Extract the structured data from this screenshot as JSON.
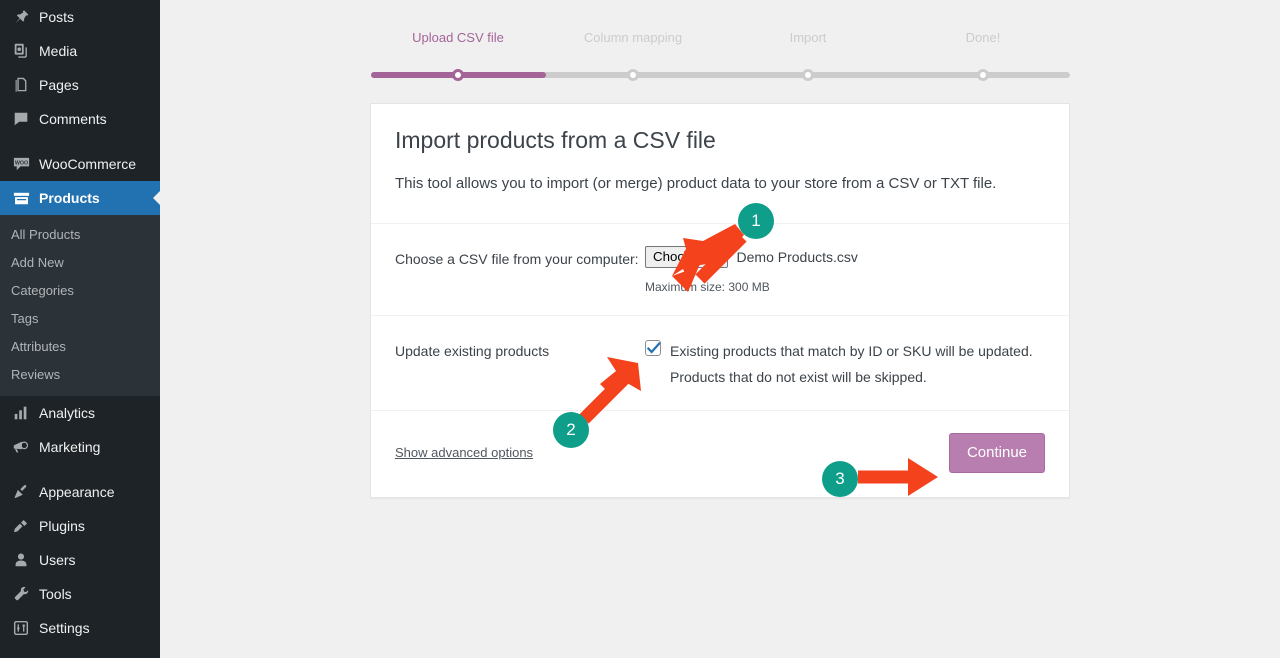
{
  "colors": {
    "sidebar_bg": "#1d2327",
    "submenu_bg": "#2c3338",
    "current_item_bg": "#2271b1",
    "page_bg": "#f0f0f1",
    "accent_purple": "#a46497",
    "button_purple": "#b87eb0",
    "annotation_teal": "#0e9e8a",
    "annotation_orange": "#f4421c",
    "checkbox_blue": "#2271b1"
  },
  "sidebar": {
    "groups": [
      {
        "items": [
          {
            "label": "Posts",
            "icon": "pin-icon",
            "current": false
          },
          {
            "label": "Media",
            "icon": "media-icon",
            "current": false
          },
          {
            "label": "Pages",
            "icon": "pages-icon",
            "current": false
          },
          {
            "label": "Comments",
            "icon": "comment-icon",
            "current": false
          }
        ]
      },
      {
        "items": [
          {
            "label": "WooCommerce",
            "icon": "woocommerce-icon",
            "current": false
          },
          {
            "label": "Products",
            "icon": "products-box-icon",
            "current": true
          }
        ],
        "submenu": [
          "All Products",
          "Add New",
          "Categories",
          "Tags",
          "Attributes",
          "Reviews"
        ]
      },
      {
        "items": [
          {
            "label": "Analytics",
            "icon": "bar-chart-icon",
            "current": false
          },
          {
            "label": "Marketing",
            "icon": "megaphone-icon",
            "current": false
          }
        ]
      },
      {
        "items": [
          {
            "label": "Appearance",
            "icon": "paintbrush-icon",
            "current": false
          },
          {
            "label": "Plugins",
            "icon": "plug-icon",
            "current": false
          },
          {
            "label": "Users",
            "icon": "user-icon",
            "current": false
          },
          {
            "label": "Tools",
            "icon": "wrench-icon",
            "current": false
          },
          {
            "label": "Settings",
            "icon": "sliders-icon",
            "current": false
          }
        ]
      }
    ]
  },
  "stepper": {
    "steps": [
      {
        "label": "Upload CSV file",
        "state": "active"
      },
      {
        "label": "Column mapping",
        "state": "upcoming"
      },
      {
        "label": "Import",
        "state": "upcoming"
      },
      {
        "label": "Done!",
        "state": "upcoming"
      }
    ],
    "progress_percent": 25
  },
  "card": {
    "title": "Import products from a CSV file",
    "description": "This tool allows you to import (or merge) product data to your store from a CSV or TXT file.",
    "file_row": {
      "label": "Choose a CSV file from your computer:",
      "button_label": "Choose file",
      "selected_file": "Demo Products.csv",
      "max_size_note": "Maximum size: 300 MB"
    },
    "update_row": {
      "label": "Update existing products",
      "checkbox_checked": true,
      "checkbox_description": "Existing products that match by ID or SKU will be updated. Products that do not exist will be skipped."
    },
    "footer": {
      "advanced_link": "Show advanced options",
      "continue_label": "Continue"
    }
  },
  "annotations": {
    "markers": [
      {
        "number": "1",
        "target": "choose-file-button",
        "arrow_direction": "down-left"
      },
      {
        "number": "2",
        "target": "update-existing-checkbox",
        "arrow_direction": "up-right"
      },
      {
        "number": "3",
        "target": "continue-button",
        "arrow_direction": "right"
      }
    ]
  }
}
